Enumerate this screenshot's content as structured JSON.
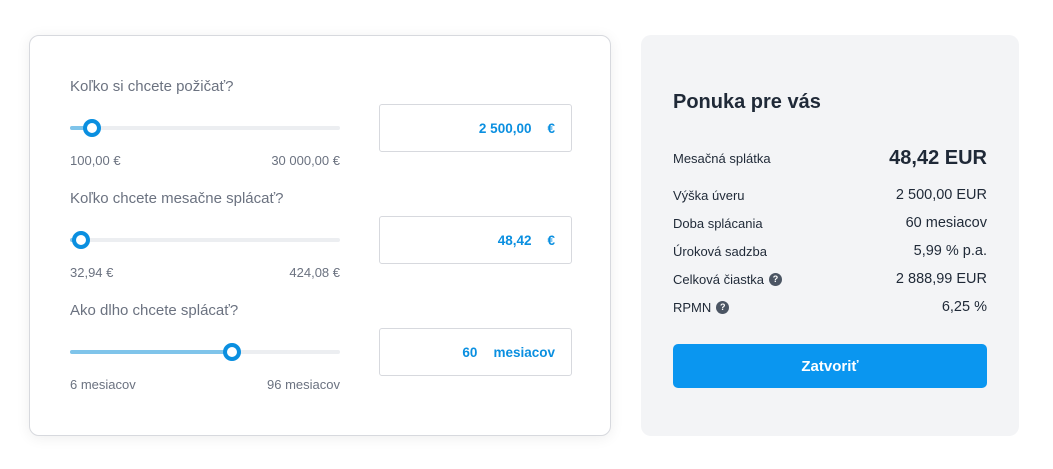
{
  "calculator": {
    "amount": {
      "question": "Koľko si chcete požičať?",
      "value": "2 500,00",
      "unit": "€",
      "min_label": "100,00 €",
      "max_label": "30 000,00 €",
      "slider_fraction": 0.08
    },
    "monthly": {
      "question": "Koľko chcete mesačne splácať?",
      "value": "48,42",
      "unit": "€",
      "min_label": "32,94 €",
      "max_label": "424,08 €",
      "slider_fraction": 0.04
    },
    "duration": {
      "question": "Ako dlho chcete splácať?",
      "value": "60",
      "unit": "mesiacov",
      "min_label": "6 mesiacov",
      "max_label": "96 mesiacov",
      "slider_fraction": 0.6
    }
  },
  "offer": {
    "title": "Ponuka pre vás",
    "rows": [
      {
        "label": "Mesačná splátka",
        "value": "48,42 EUR"
      },
      {
        "label": "Výška úveru",
        "value": "2 500,00 EUR"
      },
      {
        "label": "Doba splácania",
        "value": "60 mesiacov"
      },
      {
        "label": "Úroková sadzba",
        "value": "5,99 % p.a."
      },
      {
        "label": "Celková čiastka",
        "value": "2 888,99 EUR",
        "help": "?"
      },
      {
        "label": "RPMN",
        "value": "6,25 %",
        "help": "?"
      }
    ],
    "close_label": "Zatvoriť"
  },
  "colors": {
    "accent": "#0a8fe0",
    "button": "#0a96f0",
    "slider_fill": "#7fc4ea"
  },
  "icons": [
    "help-icon"
  ]
}
